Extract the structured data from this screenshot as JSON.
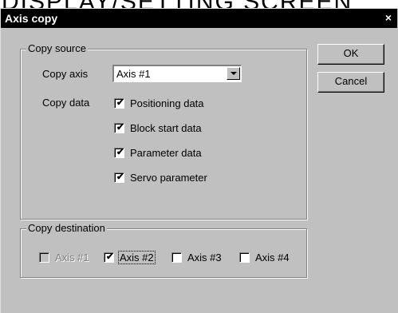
{
  "page_heading": "DISPLAY/SETTING SCREEN",
  "dialog": {
    "title": "Axis copy",
    "close_glyph": "×"
  },
  "copy_source": {
    "legend": "Copy source",
    "copy_axis_label": "Copy axis",
    "copy_axis_value": "Axis #1",
    "copy_data_label": "Copy data",
    "data_items": [
      {
        "label": "Positioning data",
        "checked": true
      },
      {
        "label": "Block start data",
        "checked": true
      },
      {
        "label": "Parameter data",
        "checked": true
      },
      {
        "label": "Servo parameter",
        "checked": true
      }
    ]
  },
  "copy_destination": {
    "legend": "Copy destination",
    "axes": [
      {
        "label": "Axis #1",
        "checked": false,
        "disabled": true
      },
      {
        "label": "Axis #2",
        "checked": true,
        "disabled": false,
        "focused": true
      },
      {
        "label": "Axis #3",
        "checked": false,
        "disabled": false
      },
      {
        "label": "Axis #4",
        "checked": false,
        "disabled": false
      }
    ]
  },
  "buttons": {
    "ok": "OK",
    "cancel": "Cancel"
  },
  "check_glyph": "✔"
}
